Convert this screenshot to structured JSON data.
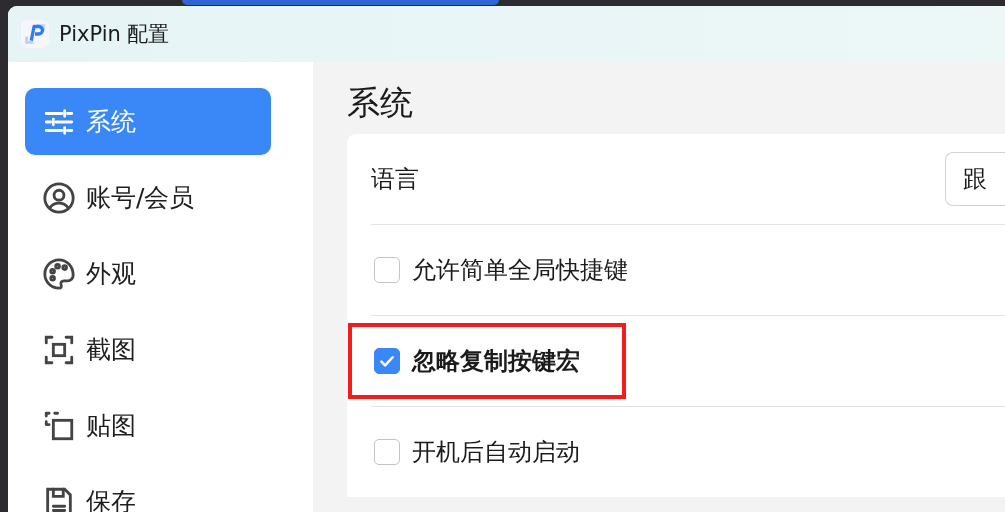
{
  "window": {
    "title": "PixPin 配置"
  },
  "sidebar": {
    "items": [
      {
        "label": "系统",
        "kind": "sliders",
        "selected": true
      },
      {
        "label": "账号/会员",
        "kind": "user",
        "selected": false
      },
      {
        "label": "外观",
        "kind": "palette",
        "selected": false
      },
      {
        "label": "截图",
        "kind": "capture",
        "selected": false
      },
      {
        "label": "贴图",
        "kind": "pin",
        "selected": false
      },
      {
        "label": "保存",
        "kind": "save",
        "selected": false
      }
    ]
  },
  "content": {
    "heading": "系统",
    "settings": [
      {
        "kind": "dropdown",
        "label": "语言",
        "value": "跟"
      },
      {
        "kind": "checkbox",
        "label": "允许简单全局快捷键",
        "checked": false,
        "bold": false,
        "highlighted": false
      },
      {
        "kind": "checkbox",
        "label": "忽略复制按键宏",
        "checked": true,
        "bold": true,
        "highlighted": true
      },
      {
        "kind": "checkbox",
        "label": "开机后自动启动",
        "checked": false,
        "bold": false,
        "highlighted": false
      }
    ]
  }
}
